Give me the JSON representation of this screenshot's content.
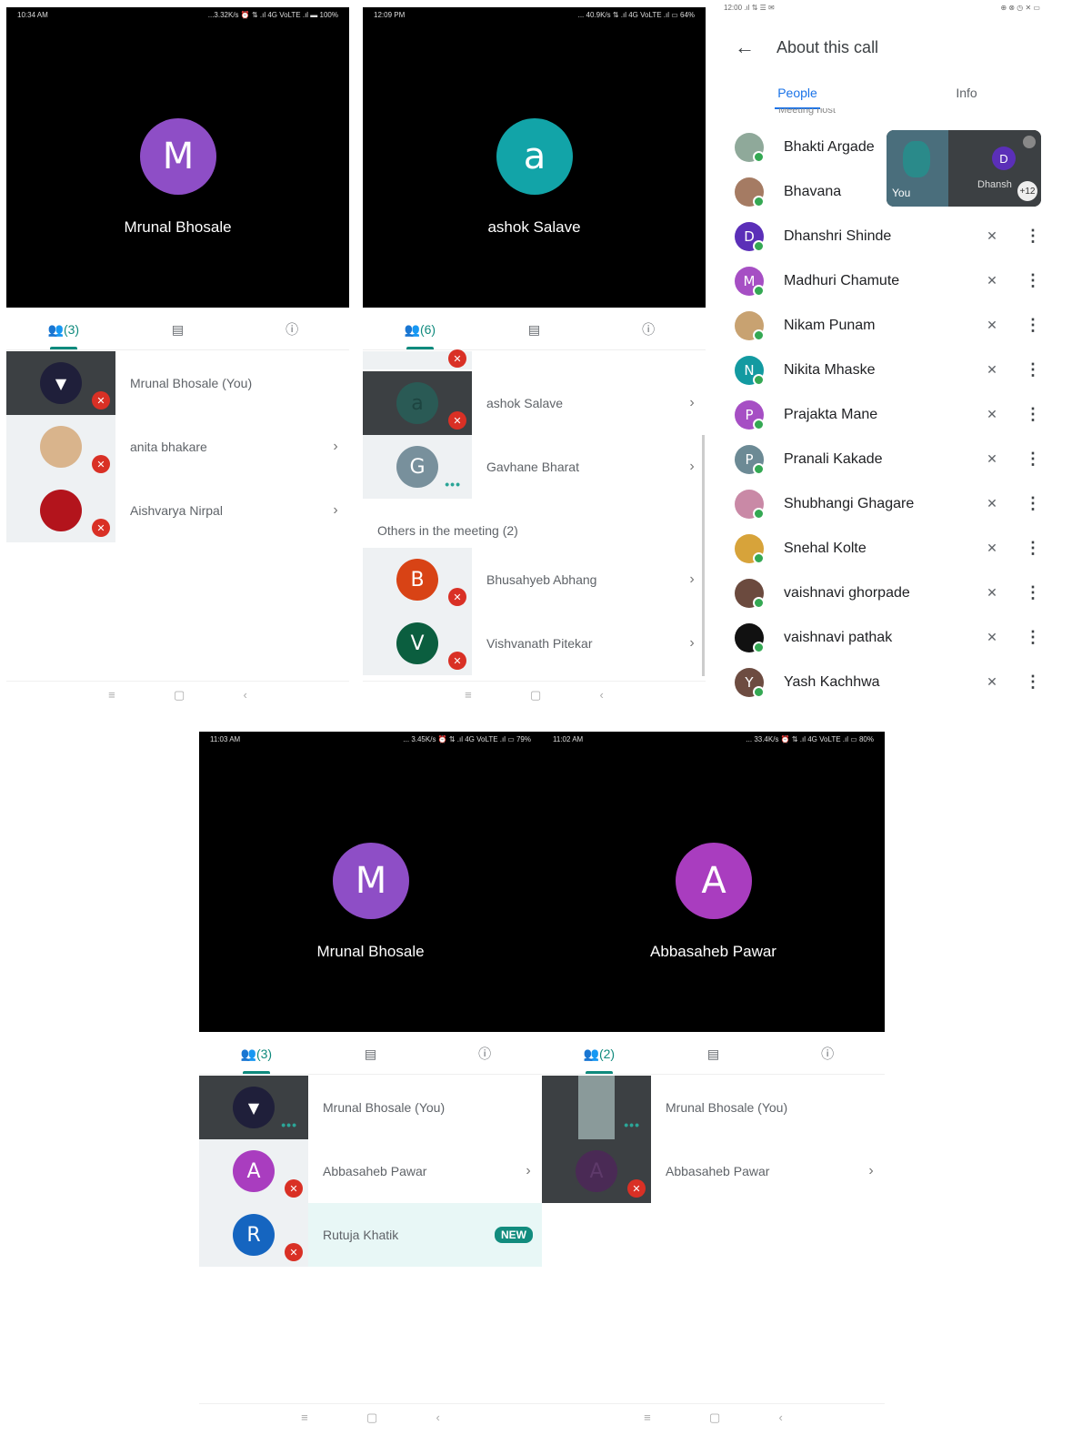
{
  "p1": {
    "status": {
      "time": "10:34 AM",
      "right": "...3.32K/s ⏰ ⇅ .ıl 4G VoLTE .ıl ▬ 100%"
    },
    "featured": {
      "initial": "M",
      "name": "Mrunal Bhosale",
      "color": "#8e4ec6"
    },
    "tabs": {
      "people": "(3)"
    },
    "rows": [
      {
        "name": "Mrunal Bhosale (You)"
      },
      {
        "name": "anita bhakare",
        "chev": "›"
      },
      {
        "name": "Aishvarya Nirpal",
        "chev": "›"
      }
    ]
  },
  "p2": {
    "status": {
      "time": "12:09 PM",
      "right": "... 40.9K/s ⇅ .ıl 4G VoLTE .ıl ▭ 64%"
    },
    "featured": {
      "initial": "a",
      "name": "ashok Salave",
      "color": "#12a4a8"
    },
    "tabs": {
      "people": "(6)"
    },
    "rows": [
      {
        "name": "ashok Salave",
        "initial": "a",
        "chev": "›"
      },
      {
        "name": "Gavhane Bharat",
        "initial": "G",
        "chev": "›"
      }
    ],
    "others_label": "Others in the meeting (2)",
    "others": [
      {
        "name": "Bhusahyeb Abhang",
        "initial": "B",
        "chev": "›"
      },
      {
        "name": "Vishvanath Pitekar",
        "initial": "V",
        "chev": "›"
      }
    ]
  },
  "p3": {
    "status": {
      "time": "12:00 .ıl ⇅ ☰ ✉",
      "right": "⊕ ⊗ ◷ ✕ ▭"
    },
    "title": "About this call",
    "tabs": {
      "people": "People",
      "info": "Info"
    },
    "cut_text": "Meeting host",
    "overlay": {
      "you": "You",
      "d_initial": "D",
      "d_name": "Dhansh",
      "count": "+12"
    },
    "people": [
      {
        "name": "Bhakti Argade",
        "initial": "",
        "color": "#8fa99a"
      },
      {
        "name": "Bhavana",
        "initial": "",
        "color": "#a57b63"
      },
      {
        "name": "Dhanshri Shinde",
        "initial": "D",
        "color": "#5b2fb8"
      },
      {
        "name": "Madhuri Chamute",
        "initial": "M",
        "color": "#a64fc4"
      },
      {
        "name": "Nikam Punam",
        "initial": "",
        "color": "#c8a271"
      },
      {
        "name": "Nikita Mhaske",
        "initial": "N",
        "color": "#139aa1"
      },
      {
        "name": "Prajakta Mane",
        "initial": "P",
        "color": "#a64fc4"
      },
      {
        "name": "Pranali Kakade",
        "initial": "P",
        "color": "#6c8a95"
      },
      {
        "name": "Shubhangi Ghagare",
        "initial": "",
        "color": "#c989a6"
      },
      {
        "name": "Snehal Kolte",
        "initial": "",
        "color": "#d7a33a"
      },
      {
        "name": "vaishnavi ghorpade",
        "initial": "",
        "color": "#6b4a3e"
      },
      {
        "name": "vaishnavi pathak",
        "initial": "",
        "color": "#111111"
      },
      {
        "name": "Yash Kachhwa",
        "initial": "Y",
        "color": "#6d4c41"
      }
    ],
    "mic_icon": "✕",
    "kebab": "⋮"
  },
  "p4": {
    "status": {
      "time": "11:03 AM",
      "right": "... 3.45K/s ⏰ ⇅ .ıl 4G VoLTE .ıl ▭ 79%"
    },
    "featured": {
      "initial": "M",
      "name": "Mrunal Bhosale",
      "color": "#8e4ec6"
    },
    "tabs": {
      "people": "(3)"
    },
    "rows": [
      {
        "name": "Mrunal Bhosale (You)"
      },
      {
        "name": "Abbasaheb Pawar",
        "initial": "A",
        "chev": "›"
      },
      {
        "name": "Rutuja Khatik",
        "initial": "R",
        "badge": "NEW"
      }
    ]
  },
  "p5": {
    "status": {
      "time": "11:02 AM",
      "right": "... 33.4K/s ⏰ ⇅ .ıl 4G VoLTE .ıl ▭ 80%"
    },
    "featured": {
      "initial": "A",
      "name": "Abbasaheb Pawar",
      "color": "#a93dbf"
    },
    "tabs": {
      "people": "(2)"
    },
    "rows": [
      {
        "name": "Mrunal Bhosale (You)"
      },
      {
        "name": "Abbasaheb Pawar",
        "initial": "A",
        "chev": "›"
      }
    ]
  },
  "icons": {
    "people": "👥",
    "chat": "▤",
    "info": "ⓘ",
    "mute": "🎙",
    "dots": "•••",
    "menu": "≡",
    "home": "▢",
    "back": "‹",
    "back_arrow": "←",
    "pin": "▼"
  }
}
